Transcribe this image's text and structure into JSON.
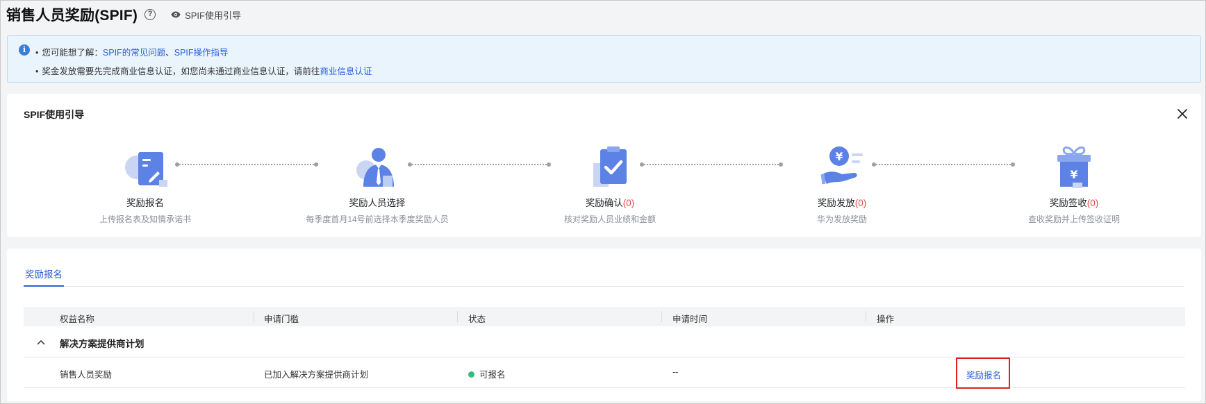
{
  "header": {
    "title": "销售人员奖励(SPIF)",
    "help_icon": "question-circle-icon",
    "guide_link": "SPIF使用引导",
    "guide_icon": "eye-icon"
  },
  "banner": {
    "icon": "info-icon",
    "line1_prefix": "您可能想了解：",
    "line1_link1": "SPIF的常见问题",
    "line1_sep": "、",
    "line1_link2": "SPIF操作指导",
    "line2_prefix": "奖金发放需要先完成商业信息认证，如您尚未通过商业信息认证，请前往",
    "line2_link": "商业信息认证"
  },
  "guide": {
    "title": "SPIF使用引导",
    "steps": [
      {
        "icon": "document-edit-icon",
        "label": "奖励报名",
        "count": "",
        "desc": "上传报名表及知情承诺书"
      },
      {
        "icon": "person-select-icon",
        "label": "奖励人员选择",
        "count": "",
        "desc": "每季度首月14号前选择本季度奖励人员"
      },
      {
        "icon": "clipboard-check-icon",
        "label": "奖励确认",
        "count": "(0)",
        "desc": "核对奖励人员业绩和金额"
      },
      {
        "icon": "hand-yuan-icon",
        "label": "奖励发放",
        "count": "(0)",
        "desc": "华为发放奖励"
      },
      {
        "icon": "gift-yuan-icon",
        "label": "奖励签收",
        "count": "(0)",
        "desc": "查收奖励并上传签收证明"
      }
    ]
  },
  "table": {
    "tab": "奖励报名",
    "columns": [
      "权益名称",
      "申请门槛",
      "状态",
      "申请时间",
      "操作"
    ],
    "group": "解决方案提供商计划",
    "rows": [
      {
        "name": "销售人员奖励",
        "threshold": "已加入解决方案提供商计划",
        "status": "可报名",
        "time": "--",
        "action": "奖励报名"
      }
    ]
  },
  "colors": {
    "accent": "#2b5fd9",
    "status_ok": "#2fbf7f",
    "count": "#e5484d",
    "highlight": "#e02020"
  }
}
